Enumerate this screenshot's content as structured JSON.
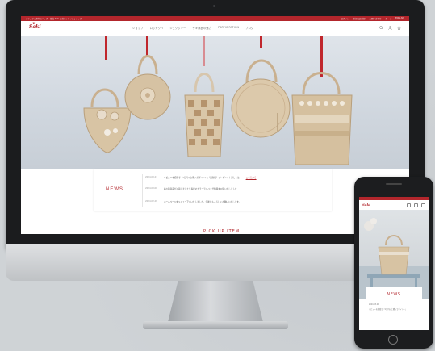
{
  "site": {
    "logo": "Saki",
    "topbar_left": "ナチュラル素材のバッグ・雑貨 Saki 公式オンラインショップ",
    "topbar_links": [
      "ログイン",
      "新規会員登録",
      "お問い合わせ",
      "カート",
      "ENGLISH"
    ],
    "nav": [
      "ショップ",
      "ロッカクバ",
      "ジュクッツー",
      "サキ商品の魅力",
      "PARTICIPATION",
      "ブログ"
    ],
    "icons": [
      "search-icon",
      "user-icon",
      "cart-icon"
    ],
    "accent": "#b3262c"
  },
  "news": {
    "title": "NEWS",
    "items": [
      {
        "date": "2024.03.21",
        "text": "レビューを投稿で「1万円以上購入でポイント」（最新版）プレゼント！詳しくは",
        "link": "こちらから"
      },
      {
        "date": "2024.03.06",
        "text": "春の新商品が入荷しました！春夏のナチュラルバッグ特集を公開いたしました",
        "link": ""
      },
      {
        "date": "2024.02.28",
        "text": "ホームページをリニューアルいたしました。今後ともよろしくお願いいたします。",
        "link": ""
      }
    ]
  },
  "section_peek": "PICK UP ITEM",
  "phone": {
    "logo": "Saki",
    "news_title": "NEWS",
    "news_lines": [
      "2024.03.21",
      "レビューを投稿で「1万円以上購入でポイント」"
    ]
  }
}
